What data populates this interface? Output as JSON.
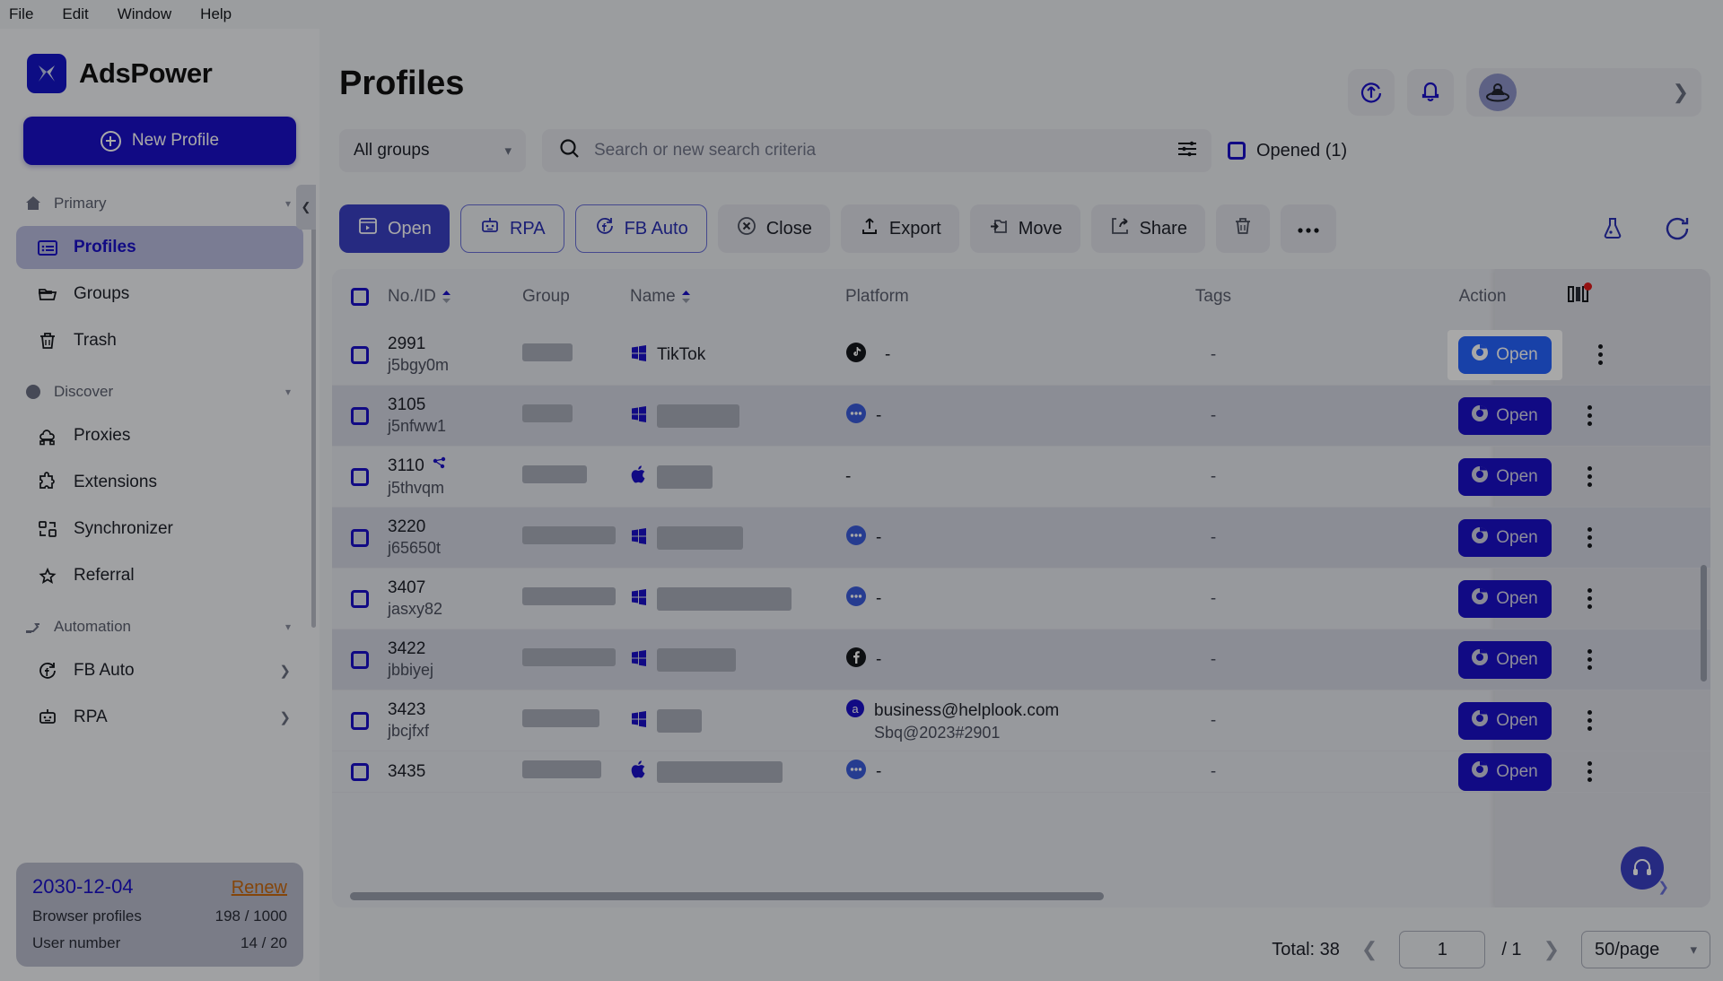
{
  "menubar": {
    "items": [
      "File",
      "Edit",
      "Window",
      "Help"
    ]
  },
  "sidebar": {
    "brand": "AdsPower",
    "new_profile_label": "New Profile",
    "sections": [
      {
        "label": "Primary",
        "icon": "home-icon",
        "items": [
          {
            "label": "Profiles",
            "icon": "profiles-icon",
            "active": true
          },
          {
            "label": "Groups",
            "icon": "folder-icon",
            "active": false
          },
          {
            "label": "Trash",
            "icon": "trash-icon",
            "active": false
          }
        ]
      },
      {
        "label": "Discover",
        "icon": "compass-icon",
        "items": [
          {
            "label": "Proxies",
            "icon": "proxy-cloud-icon",
            "active": false
          },
          {
            "label": "Extensions",
            "icon": "puzzle-icon",
            "active": false
          },
          {
            "label": "Synchronizer",
            "icon": "synchronizer-icon",
            "active": false
          },
          {
            "label": "Referral",
            "icon": "star-icon",
            "active": false
          }
        ]
      },
      {
        "label": "Automation",
        "icon": "automation-icon",
        "items": [
          {
            "label": "FB Auto",
            "icon": "facebook-sync-icon",
            "active": false,
            "chevron": true
          },
          {
            "label": "RPA",
            "icon": "robot-icon",
            "active": false,
            "chevron": true
          }
        ]
      }
    ],
    "plan": {
      "expiry_date": "2030-12-04",
      "renew_label": "Renew",
      "rows": [
        {
          "label": "Browser profiles",
          "value": "198 / 1000"
        },
        {
          "label": "User number",
          "value": "14 / 20"
        }
      ]
    }
  },
  "header": {
    "title": "Profiles",
    "icons": [
      "refresh-upload-icon",
      "bell-icon"
    ],
    "account_avatar": "alien-avatar"
  },
  "filters": {
    "group_select": "All groups",
    "search_placeholder": "Search or new search criteria",
    "search_value": "",
    "advanced_filter_icon": "sliders-icon",
    "opened_label": "Opened (1)"
  },
  "toolbar": {
    "buttons": [
      {
        "label": "Open",
        "icon": "window-play-icon",
        "style": "primary"
      },
      {
        "label": "RPA",
        "icon": "robot-icon",
        "style": "outline"
      },
      {
        "label": "FB Auto",
        "icon": "facebook-sync-icon",
        "style": "outline"
      },
      {
        "label": "Close",
        "icon": "x-circle-icon",
        "style": "plain"
      },
      {
        "label": "Export",
        "icon": "upload-icon",
        "style": "plain"
      },
      {
        "label": "Move",
        "icon": "move-folder-icon",
        "style": "plain"
      },
      {
        "label": "Share",
        "icon": "share-icon",
        "style": "plain"
      },
      {
        "label": "",
        "icon": "trash-icon",
        "style": "plain"
      },
      {
        "label": "",
        "icon": "more-dots-icon",
        "style": "plain"
      }
    ],
    "right_icons": [
      "flask-icon",
      "refresh-icon"
    ]
  },
  "table": {
    "columns": [
      "No./ID",
      "Group",
      "Name",
      "Platform",
      "Tags",
      "Action"
    ],
    "column_settings_icon": "columns-icon",
    "rows": [
      {
        "no": "2991",
        "id": "j5bgy0m",
        "group": "",
        "name": "TikTok",
        "name_icon": "windows-icon",
        "platform": "",
        "platform_icon": "tiktok-icon",
        "platform_sub": "",
        "tags": "-",
        "action": "Open",
        "highlight": true,
        "shared": false
      },
      {
        "no": "3105",
        "id": "j5nfww1",
        "group": "",
        "name": "",
        "name_icon": "windows-icon",
        "platform": "",
        "platform_icon": "dots-icon",
        "platform_sub": "",
        "tags": "-",
        "action": "Open",
        "highlight": false,
        "shared": false
      },
      {
        "no": "3110",
        "id": "j5thvqm",
        "group": "",
        "name": "",
        "name_icon": "apple-icon",
        "platform": "",
        "platform_icon": "",
        "platform_sub": "",
        "tags": "-",
        "action": "Open",
        "highlight": false,
        "shared": true
      },
      {
        "no": "3220",
        "id": "j65650t",
        "group": "",
        "name": "",
        "name_icon": "windows-icon",
        "platform": "",
        "platform_icon": "dots-icon",
        "platform_sub": "",
        "tags": "-",
        "action": "Open",
        "highlight": false,
        "shared": false
      },
      {
        "no": "3407",
        "id": "jasxy82",
        "group": "",
        "name": "",
        "name_icon": "windows-icon",
        "platform": "",
        "platform_icon": "dots-icon",
        "platform_sub": "",
        "tags": "-",
        "action": "Open",
        "highlight": false,
        "shared": false
      },
      {
        "no": "3422",
        "id": "jbbiyej",
        "group": "",
        "name": "",
        "name_icon": "windows-icon",
        "platform": "",
        "platform_icon": "facebook-icon",
        "platform_sub": "",
        "tags": "-",
        "action": "Open",
        "highlight": false,
        "shared": false
      },
      {
        "no": "3423",
        "id": "jbcjfxf",
        "group": "",
        "name": "",
        "name_icon": "windows-icon",
        "platform": "business@helplook.com",
        "platform_icon": "amazon-a-icon",
        "platform_sub": "Sbq@2023#2901",
        "tags": "-",
        "action": "Open",
        "highlight": false,
        "shared": false
      },
      {
        "no": "3435",
        "id": "",
        "group": "",
        "name": "",
        "name_icon": "apple-icon",
        "platform": "",
        "platform_icon": "dots-icon",
        "platform_sub": "",
        "tags": "-",
        "action": "Open",
        "highlight": false,
        "shared": false
      }
    ]
  },
  "footer": {
    "total_label": "Total: 38",
    "page_value": "1",
    "page_total": "/ 1",
    "page_size": "50/page"
  },
  "colors": {
    "brand_blue": "#1b10c8",
    "accent_blue": "#2563ff",
    "renew_orange": "#c96a10",
    "badge_red": "#e01b1b"
  }
}
